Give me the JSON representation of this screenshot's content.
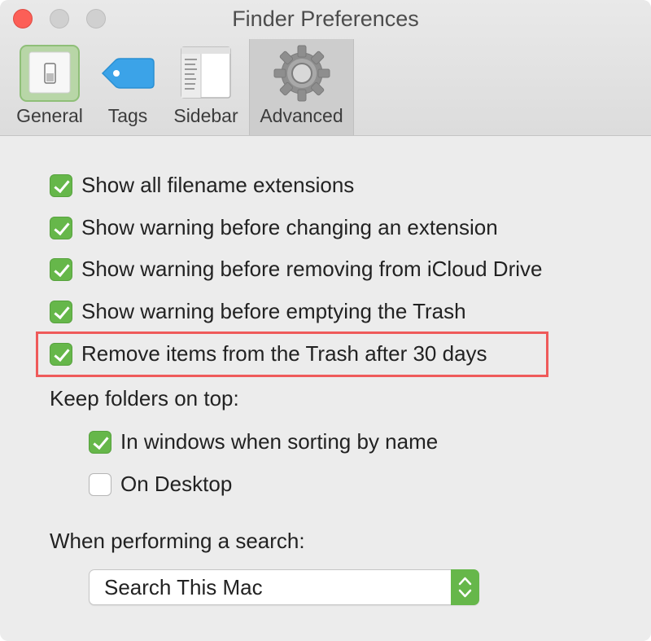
{
  "window": {
    "title": "Finder Preferences"
  },
  "tabs": [
    {
      "label": "General",
      "icon": "switch-icon",
      "selected": false
    },
    {
      "label": "Tags",
      "icon": "tag-icon",
      "selected": false
    },
    {
      "label": "Sidebar",
      "icon": "sidebar-icon",
      "selected": false
    },
    {
      "label": "Advanced",
      "icon": "gear-icon",
      "selected": true
    }
  ],
  "options": [
    {
      "label": "Show all filename extensions",
      "checked": true
    },
    {
      "label": "Show warning before changing an extension",
      "checked": true
    },
    {
      "label": "Show warning before removing from iCloud Drive",
      "checked": true
    },
    {
      "label": "Show warning before emptying the Trash",
      "checked": true
    },
    {
      "label": "Remove items from the Trash after 30 days",
      "checked": true
    }
  ],
  "keep_folders": {
    "heading": "Keep folders on top:",
    "options": [
      {
        "label": "In windows when sorting by name",
        "checked": true
      },
      {
        "label": "On Desktop",
        "checked": false
      }
    ]
  },
  "search": {
    "heading": "When performing a search:",
    "selected": "Search This Mac"
  },
  "colors": {
    "accent_green": "#66b74a",
    "highlight_red": "#ef5a5a",
    "close_red": "#fc5f57"
  }
}
